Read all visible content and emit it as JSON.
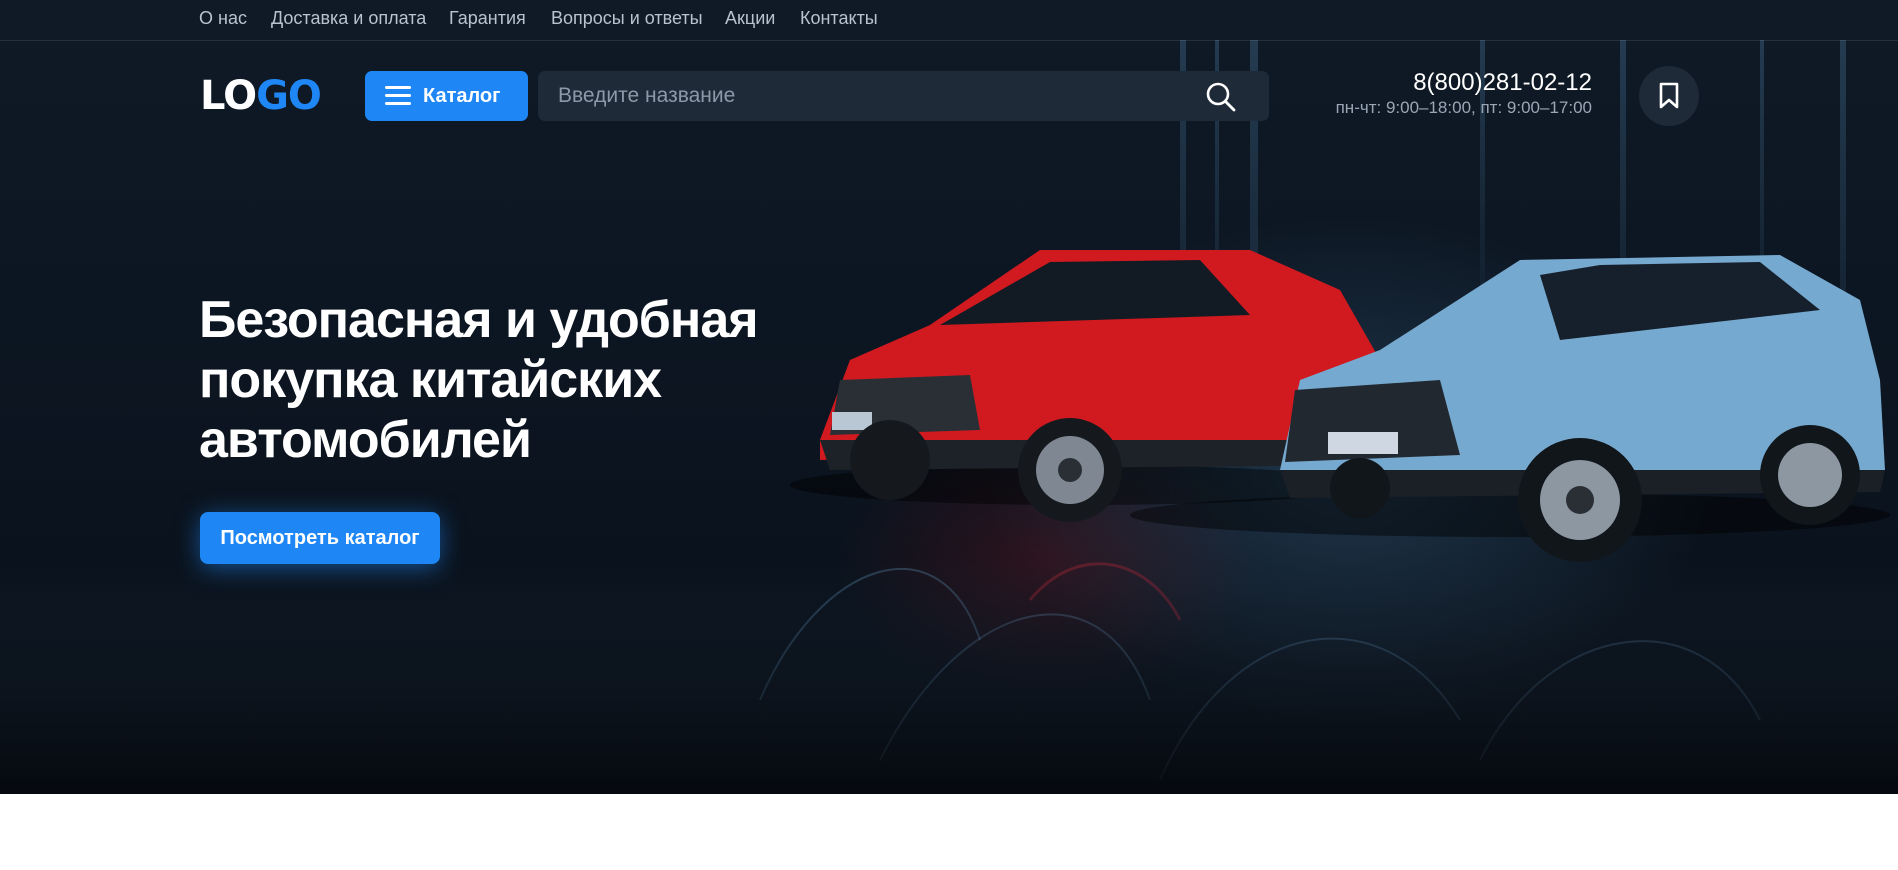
{
  "topnav": {
    "links": [
      "О нас",
      "Доставка и оплата",
      "Гарантия",
      "Вопросы и ответы",
      "Акции",
      "Контакты"
    ]
  },
  "header": {
    "logo_part1": "LO",
    "logo_part2": "GO",
    "catalog_label": "Каталог",
    "search_placeholder": "Введите название",
    "phone": "8(800)281-02-12",
    "hours": "пн-чт: 9:00–18:00, пт: 9:00–17:00"
  },
  "hero": {
    "headline_line1": "Безопасная и удобная",
    "headline_line2": "покупка китайских",
    "headline_line3": "автомобилей",
    "cta_label": "Посмотреть каталог"
  },
  "colors": {
    "accent": "#1f86f5",
    "dark_bg": "#0c1622",
    "field_bg": "#1e2a38"
  },
  "icons": {
    "catalog": "menu-icon",
    "search": "search-icon",
    "bookmark": "bookmark-icon"
  }
}
